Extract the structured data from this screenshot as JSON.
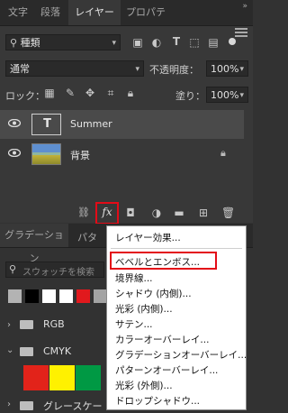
{
  "tabs": [
    {
      "label": "文字"
    },
    {
      "label": "段落"
    },
    {
      "label": "レイヤー"
    },
    {
      "label": "プロパティ"
    }
  ],
  "layers_panel": {
    "filter_kind": "種類",
    "blend_mode": "通常",
    "opacity_label": "不透明度：",
    "opacity_value": "100%",
    "lock_label": "ロック：",
    "fill_label": "塗り：",
    "fill_value": "100%",
    "layers": [
      {
        "name": "Summer",
        "thumb_glyph": "T"
      },
      {
        "name": "背景"
      }
    ]
  },
  "lower_panel": {
    "tab_gradient": "グラデーション",
    "tab_pattern_partial": "パタ",
    "search_placeholder": "スウォッチを検索",
    "folders": [
      "RGB",
      "CMYK",
      "グレースケー"
    ]
  },
  "fx_menu": {
    "items": [
      "レイヤー効果...",
      "ベベルとエンボス...",
      "境界線...",
      "シャドウ (内側)...",
      "光彩 (内側)...",
      "サテン...",
      "カラーオーバーレイ...",
      "グラデーションオーバーレイ...",
      "パターンオーバーレイ...",
      "光彩 (外側)...",
      "ドロップシャドウ..."
    ]
  },
  "colors": {
    "highlight": "#e30b17",
    "panel_bg": "#383838",
    "selected_layer": "#4a4a4a"
  }
}
